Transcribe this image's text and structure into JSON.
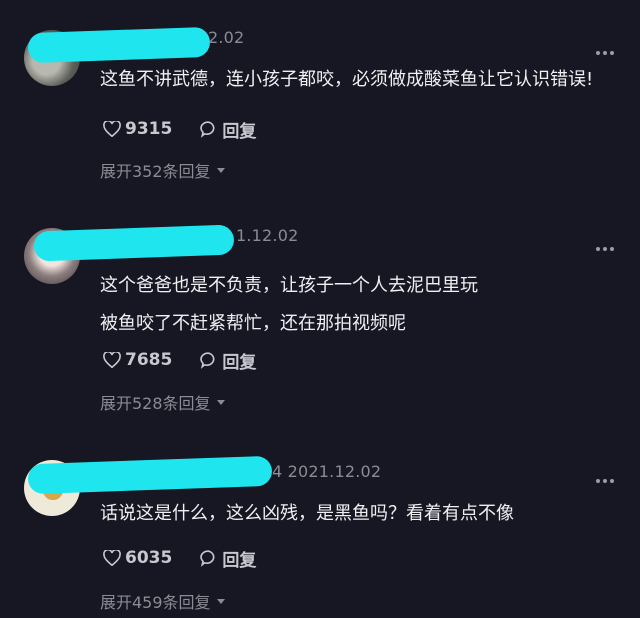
{
  "comments": [
    {
      "date": "2.02",
      "text_lines": [
        "这鱼不讲武德，连小孩子都咬，必须做成酸菜鱼让它认识错误!"
      ],
      "likes": "9315",
      "reply_label": "回复",
      "expand_replies": "展开352条回复"
    },
    {
      "date": "1.12.02",
      "text_lines": [
        "这个爸爸也是不负责，让孩子一个人去泥巴里玩",
        "被鱼咬了不赶紧帮忙，还在那拍视频呢"
      ],
      "likes": "7685",
      "reply_label": "回复",
      "expand_replies": "展开528条回复"
    },
    {
      "date": "4  2021.12.02",
      "text_lines": [
        "话说这是什么，这么凶残，是黑鱼吗？看着有点不像"
      ],
      "likes": "6035",
      "reply_label": "回复",
      "expand_replies": "展开459条回复"
    }
  ],
  "colors": {
    "background": "#161722",
    "redaction": "#1fe6ee",
    "meta_text": "#8a8b93"
  },
  "icons": [
    "heart-icon",
    "comment-bubble-icon",
    "more-options-icon",
    "chevron-down-icon"
  ]
}
